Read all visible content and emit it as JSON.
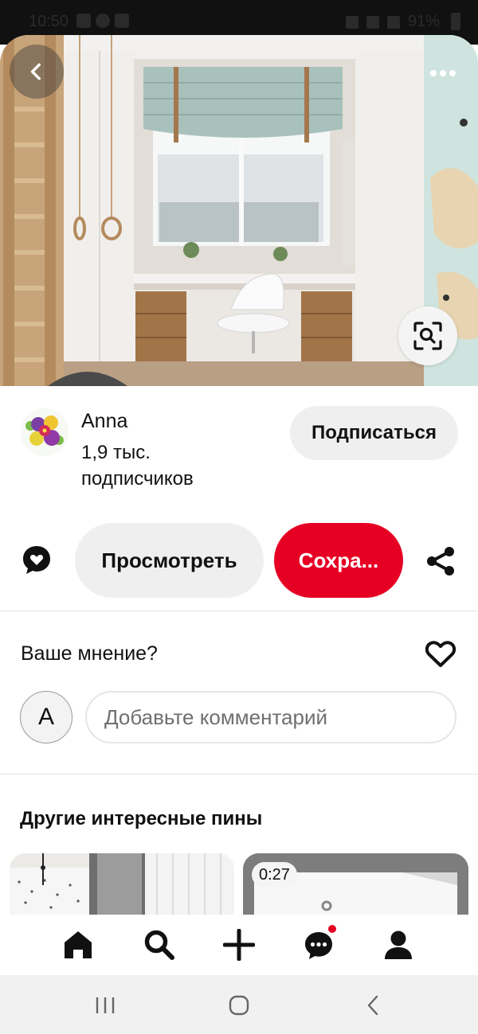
{
  "status_bar": {
    "time": "10:50",
    "battery": "91%"
  },
  "hero": {
    "alt_icons": [
      "back-icon",
      "more-icon",
      "visual-search-icon"
    ]
  },
  "author": {
    "name": "Anna",
    "followers": "1,9 тыс. подписчиков",
    "follow_label": "Подписаться"
  },
  "actions": {
    "view_label": "Просмотреть",
    "save_label": "Сохра...",
    "accent": "#e60023"
  },
  "comments": {
    "prompt": "Ваше мнение?",
    "user_initial": "A",
    "placeholder": "Добавьте комментарий"
  },
  "more_pins": {
    "title": "Другие интересные пины",
    "pins": [
      {
        "duration": ""
      },
      {
        "duration": "0:27"
      }
    ]
  },
  "bottom_nav": {
    "items": [
      "home-icon",
      "search-icon",
      "create-icon",
      "messages-icon",
      "profile-icon"
    ],
    "notification_dot": "#e60023"
  },
  "system_nav": [
    "recents-icon",
    "home-circle-icon",
    "back-chevron-icon"
  ]
}
